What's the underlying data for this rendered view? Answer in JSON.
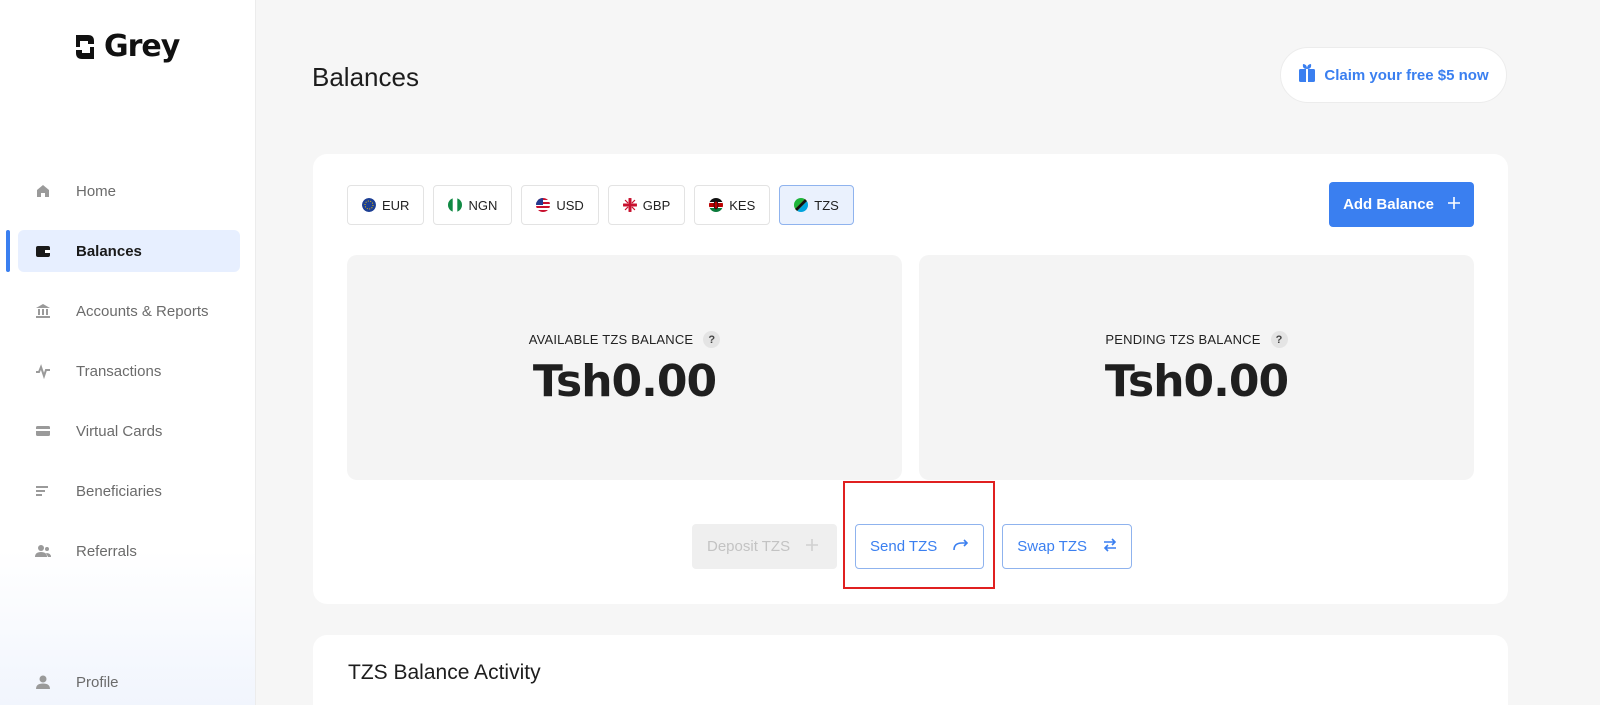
{
  "brand": {
    "name": "Grey"
  },
  "sidebar": {
    "items": [
      {
        "label": "Home",
        "icon": "home-icon"
      },
      {
        "label": "Balances",
        "icon": "wallet-icon",
        "active": true
      },
      {
        "label": "Accounts & Reports",
        "icon": "bank-icon"
      },
      {
        "label": "Transactions",
        "icon": "activity-icon"
      },
      {
        "label": "Virtual Cards",
        "icon": "card-icon"
      },
      {
        "label": "Beneficiaries",
        "icon": "list-icon"
      },
      {
        "label": "Referrals",
        "icon": "users-icon"
      }
    ],
    "profile": "Profile"
  },
  "header": {
    "title": "Balances",
    "claim_label": "Claim your free $5 now"
  },
  "currency_tabs": [
    {
      "code": "EUR"
    },
    {
      "code": "NGN"
    },
    {
      "code": "USD"
    },
    {
      "code": "GBP"
    },
    {
      "code": "KES"
    },
    {
      "code": "TZS",
      "active": true
    }
  ],
  "add_balance_label": "Add Balance",
  "balances": {
    "available_label": "AVAILABLE TZS BALANCE",
    "available_amount": "Tsh0.00",
    "pending_label": "PENDING TZS BALANCE",
    "pending_amount": "Tsh0.00",
    "help": "?"
  },
  "actions": {
    "deposit": "Deposit TZS",
    "send": "Send TZS",
    "swap": "Swap TZS"
  },
  "activity": {
    "title": "TZS Balance Activity"
  },
  "colors": {
    "accent": "#3a7ff0",
    "highlight": "#e02020"
  }
}
